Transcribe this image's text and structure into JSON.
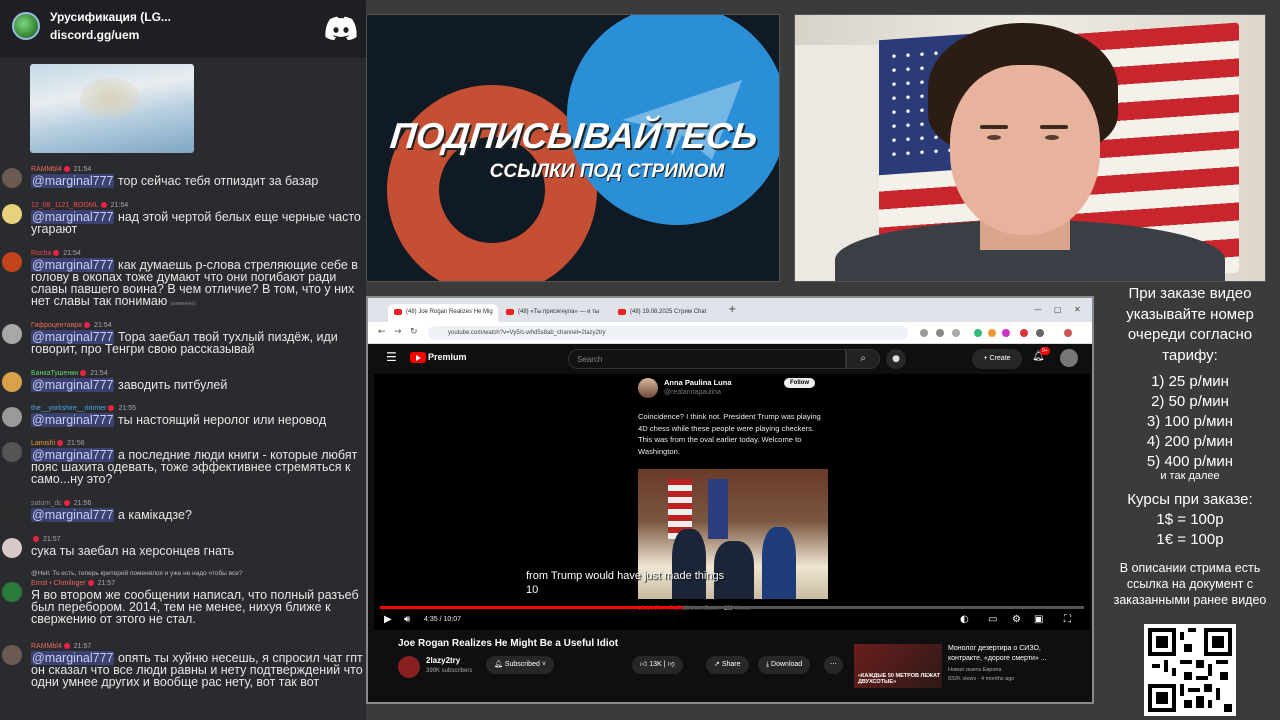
{
  "discord": {
    "title": "Урусификация (LG...",
    "link": "discord.gg/uem"
  },
  "chat": [
    {
      "name": "RAMMbl4",
      "name_color": "#e86a5a",
      "time": "21:54",
      "avatar_color": "#6a5a4f",
      "mention": "@marginal777",
      "text": " тор сейчас тебя отпиздит за базар"
    },
    {
      "name": "12_08_1121_BOOML",
      "name_color": "#e84d4d",
      "time": "21:54",
      "avatar_color": "#e6d27a",
      "mention": "@marginal777",
      "text": " над этой чертой белых еще черные часто угарают"
    },
    {
      "name": "Rocha",
      "name_color": "#e84d4d",
      "time": "21:54",
      "avatar_color": "#c2421c",
      "mention": "@marginal777",
      "text": " как думаешь р-слова стреляющие себе в голову в окопах тоже думают что они погибают ради славы павшего воина? В чем отличие? В том, что у них нет славы так понимаю",
      "edited": "(изменено)"
    },
    {
      "name": "Гифроцентавра",
      "name_color": "#e86a5a",
      "time": "21:54",
      "avatar_color": "#a8a8a8",
      "mention": "@marginal777",
      "text": " Тора заебал твой тухлый пиздёж, иди говорит, про Тенгри свою рассказывай"
    },
    {
      "name": "БанкаТушенки",
      "name_color": "#67d46e",
      "time": "21:54",
      "avatar_color": "#d9a24a",
      "mention": "@marginal777",
      "text": " заводить питбулей"
    },
    {
      "name": "the__yorkshire__rimmer",
      "name_color": "#4aa8e8",
      "time": "21:55",
      "avatar_color": "#9a9a9a",
      "mention": "@marginal777",
      "text": " ты настоящий неролог или нерoвод"
    },
    {
      "name": "Lamishi",
      "name_color": "#e0a040",
      "time": "21:56",
      "avatar_color": "#555",
      "mention": "@marginal777",
      "text": " а последние люди книги - которые любят пояс шахита одевать, тоже эффективнее стремяться к само...ну это?"
    },
    {
      "name": "saturn_dc",
      "name_color": "#8a8a8a",
      "time": "21:56",
      "avatar_color": "#2a2a2a",
      "mention": "@marginal777",
      "text": " а камікадзе?"
    },
    {
      "name": "",
      "name_color": "#8a8a8a",
      "time": "21:57",
      "avatar_color": "#d8c8c8",
      "mention": "",
      "text": "сука ты заебал на херсонцев гнать"
    },
    {
      "reply": "@Heil: То есть, теперь критерий поменялся и уже не надо чтобы все?",
      "name": "Ernst • Chmilnger",
      "name_color": "#e86a5a",
      "time": "21:57",
      "avatar_color": "#2a7a3a",
      "mention": "",
      "text": "Я во втором же сообщении написал, что полный разъеб был перебором. 2014, тем не менее, нихуя ближе к свержению от этого не стал."
    },
    {
      "name": "RAMMbl4",
      "name_color": "#e86a5a",
      "time": "21:57",
      "avatar_color": "#6a5a4f",
      "mention": "@marginal777",
      "text": " опять ты хуйню несешь, я спросил чат гпт он сказал что все люди равны и нету подтверждений что одни умнее других и вообще рас нету, вот так вот"
    }
  ],
  "promo": {
    "title": "ПОДПИСЫВАЙТЕСЬ",
    "subtitle": "ССЫЛКИ ПОД СТРИМОМ"
  },
  "browser": {
    "tabs": [
      "(48) Joe Rogan Realizes He Mig",
      "(48) «Ты присягнула» — и ты",
      "(48) 19.08.2025 Стрим Chat"
    ],
    "url": "youtube.com/watch?v=Vy5/c-whd5s8ab_channel=2lazy2try"
  },
  "youtube": {
    "brand": "Premium",
    "search_placeholder": "Search",
    "create_label": "Create",
    "notif_count": "9+",
    "tweet": {
      "name": "Anna Paulina Luna",
      "handle": "@realannapaulina",
      "follow": "Follow",
      "text": "Coincidence? I think not. President Trump was playing 4D chess while these people were playing checkers. This was from the oval earlier today. Welcome to Washington.",
      "meta_time": "10:10 PM · 7/17/25 from Earth",
      "meta_views": "2M",
      "meta_views_label": "Views"
    },
    "caption_line1": "from Trump would have just made things",
    "caption_line2": "10",
    "progress": 0.43,
    "time": "4:35 / 10:07",
    "video_title": "Joe Rogan Realizes He Might Be a Useful Idiot",
    "channel": "2lazy2try",
    "subscribers": "399K subscribers",
    "subscribed_label": "Subscribed",
    "likes": "13K",
    "share_label": "Share",
    "download_label": "Download",
    "rec_title": "Монолог дезертира о СИЗО, контракте, «дороге смерти» ...",
    "rec_channel": "Новая газета Европа",
    "rec_views": "832K views · 4 months ago",
    "rec_thumb_text": "«КАЖДЫЕ 50 МЕТРОВ ЛЕЖАТ ДВУХСОТЫЕ»"
  },
  "info": {
    "heading": "При заказе видео указывайте номер очереди согласно тарифу:",
    "rates": [
      "1) 25 р/мин",
      "2) 50 р/мин",
      "3) 100 р/мин",
      "4) 200 р/мин",
      "5) 400 р/мин"
    ],
    "etc": "и так далее",
    "courses": "Курсы при заказе:\n1$ = 100р\n1€ = 100р",
    "footer": "В описании стрима есть ссылка на документ с заказанными ранее видео"
  }
}
